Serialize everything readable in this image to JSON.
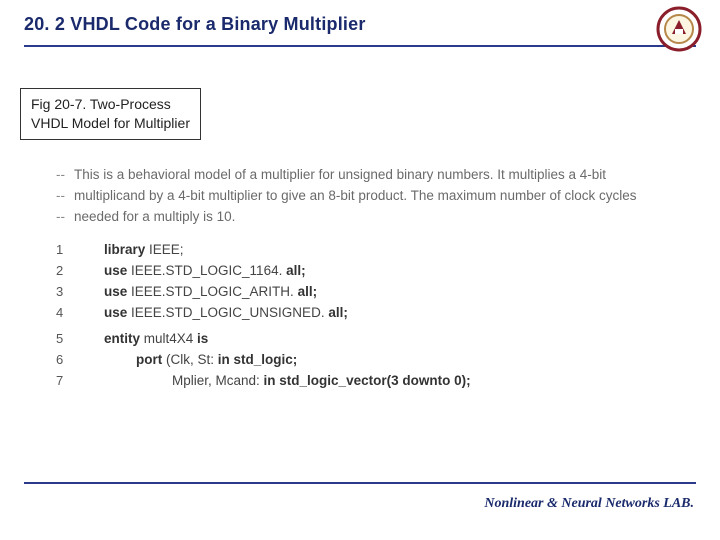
{
  "header": {
    "title": "20. 2 VHDL Code for a Binary Multiplier"
  },
  "figure": {
    "caption_line1": "Fig 20-7. Two-Process",
    "caption_line2": "VHDL Model for Multiplier"
  },
  "comments": [
    "This is a behavioral model of a multiplier for unsigned binary numbers. It multiplies a 4-bit",
    "multiplicand by a 4-bit multiplier to give an 8-bit product. The maximum number of clock cycles",
    "needed for a multiply is 10."
  ],
  "code": {
    "lines": [
      {
        "n": "1",
        "indent": 0,
        "pre": "library ",
        "mid": "IEEE;",
        "post": ""
      },
      {
        "n": "2",
        "indent": 0,
        "pre": "use ",
        "mid": "IEEE.STD_LOGIC_1164. ",
        "post": "all;"
      },
      {
        "n": "3",
        "indent": 0,
        "pre": "use ",
        "mid": "IEEE.STD_LOGIC_ARITH. ",
        "post": "all;"
      },
      {
        "n": "4",
        "indent": 0,
        "pre": "use ",
        "mid": "IEEE.STD_LOGIC_UNSIGNED. ",
        "post": "all;"
      },
      {
        "n": "",
        "indent": 0,
        "pre": "",
        "mid": "",
        "post": ""
      },
      {
        "n": "5",
        "indent": 0,
        "pre": "entity ",
        "mid": "mult4X4 ",
        "post": "is"
      },
      {
        "n": "6",
        "indent": 1,
        "pre": "port ",
        "mid": "(Clk, St: ",
        "post": "in std_logic;"
      },
      {
        "n": "7",
        "indent": 2,
        "pre": "",
        "mid": "Mplier, Mcand: ",
        "post": "in std_logic_vector(3 downto 0);"
      }
    ]
  },
  "footer": {
    "text": "Nonlinear & Neural Networks LAB."
  },
  "logo": {
    "name": "university-seal"
  }
}
